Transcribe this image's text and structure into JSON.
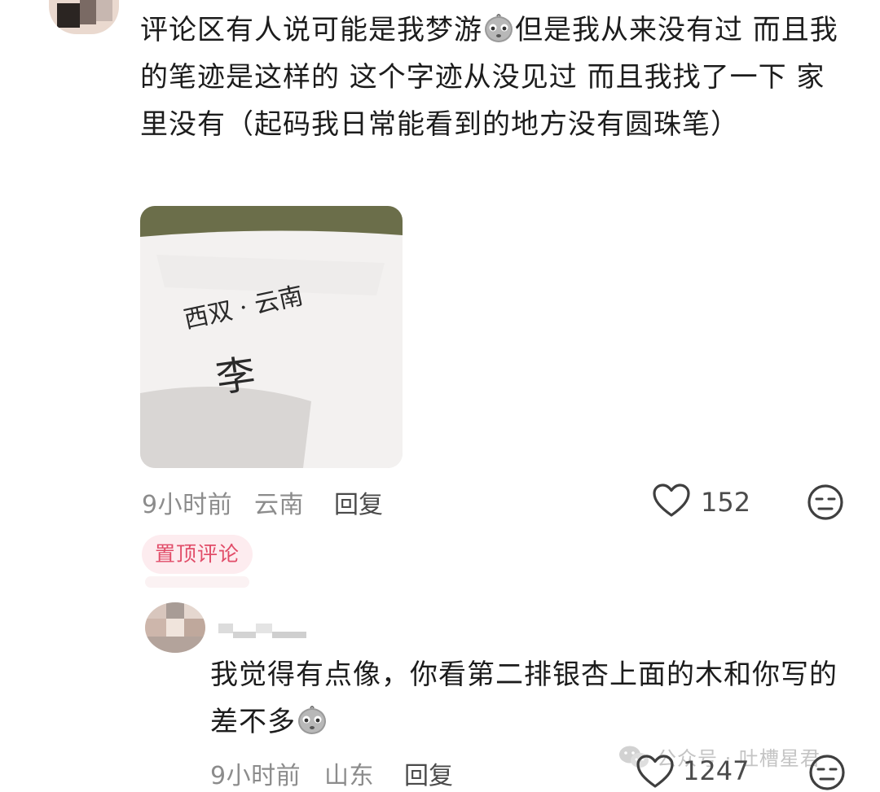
{
  "comment": {
    "text": "评论区有人说可能是我梦游",
    "text_after_emoji": "但是我从来没有过 而且我的笔迹是这样的 这个字迹从没见过 而且我找了一下 家里没有（起码我日常能看到的地方没有圆珠笔）",
    "photo_handwriting_line1": "西双 · 云南",
    "photo_handwriting_line2": "李",
    "time": "9小时前",
    "location": "云南",
    "reply_label": "回复",
    "like_count": "152",
    "pin_badge": "置顶评论"
  },
  "reply": {
    "text": "我觉得有点像，你看第二排银杏上面的木和你写的差不多",
    "time": "9小时前",
    "location": "山东",
    "reply_label": "回复",
    "like_count": "1247"
  },
  "watermark": {
    "text": "公众号 · 吐槽星君"
  },
  "icons": {
    "emoji": "crying-face-emoji",
    "like": "heart-outline-icon",
    "dislike": "neutral-face-icon",
    "watermark": "wechat-icon"
  }
}
